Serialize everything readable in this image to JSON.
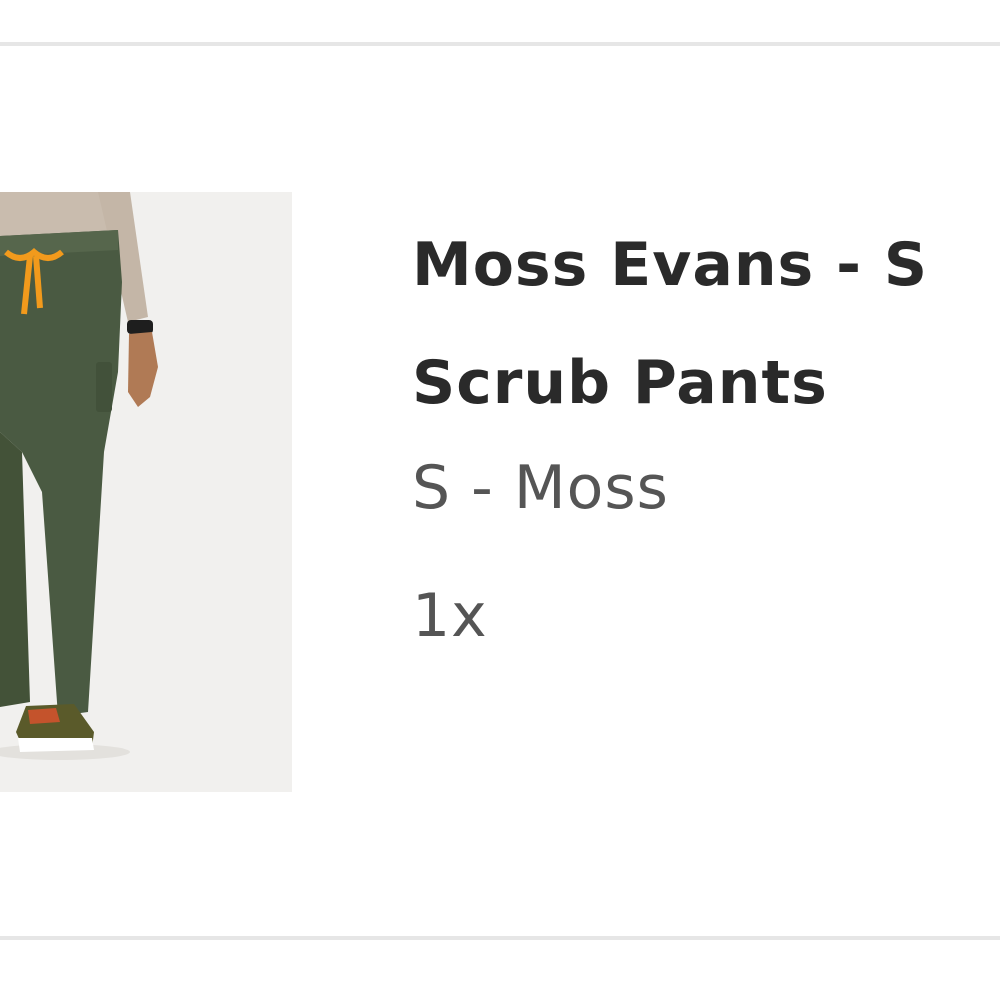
{
  "cart_item": {
    "title_line1": "Moss Evans - S",
    "title_line2": "Scrub Pants",
    "variant": "S - Moss",
    "quantity": "1x",
    "image": "product-photo-model-wearing-moss-green-scrub-pants"
  },
  "colors": {
    "pants": "#4a5a42",
    "drawstring": "#f29a1c",
    "top": "#c9bcae",
    "skin": "#b07a55",
    "divider": "#e6e6e6"
  }
}
